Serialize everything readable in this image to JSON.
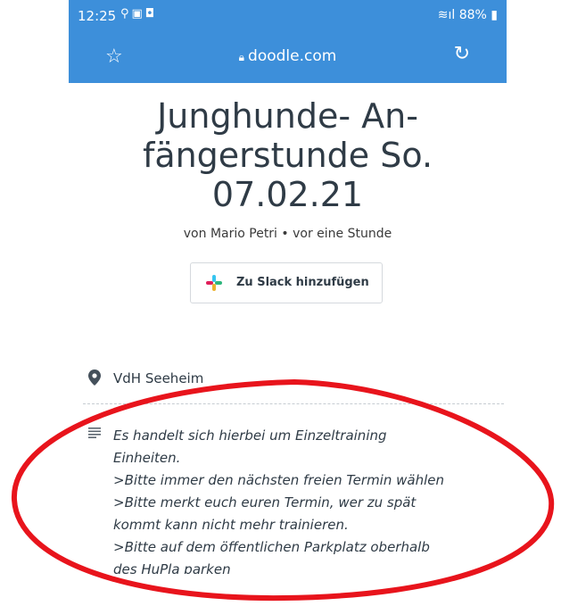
{
  "statusbar": {
    "time": "12:25",
    "left_icons": [
      "location-icon",
      "bag-icon",
      "notification-icon"
    ],
    "right_text": "88%",
    "right_icons": [
      "wifi-icon",
      "signal-icon",
      "battery-icon"
    ]
  },
  "browser": {
    "url": "doodle.com",
    "icons": [
      "star-icon",
      "lock-icon",
      "reload-icon"
    ]
  },
  "poll": {
    "title_lines": [
      "Junghunde- An-",
      "fängerstunde So.",
      "07.02.21"
    ],
    "byline": "von Mario Petri • vor eine Stunde",
    "slack_button": "Zu Slack hinzufügen",
    "location": "VdH Seeheim",
    "description_lines": [
      "Es handelt sich hierbei um Einzeltraining",
      "Einheiten.",
      ">Bitte immer den nächsten freien Termin wählen",
      ">Bitte merkt euch euren Termin, wer zu spät",
      "kommt kann nicht mehr trainieren.",
      ">Bitte auf dem öffentlichen Parkplatz oberhalb",
      "des HuPla parken"
    ]
  },
  "colors": {
    "browser_bar": "#3d8fda",
    "title_text": "#2f3b46",
    "annotation_ellipse": "#e8141c"
  }
}
